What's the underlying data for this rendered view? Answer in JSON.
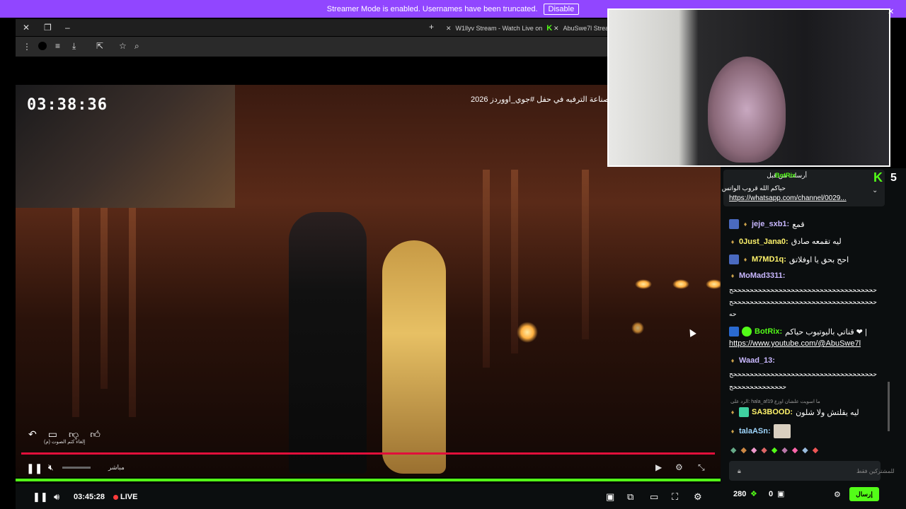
{
  "banner": {
    "text": "Streamer Mode is enabled. Usernames have been truncated.",
    "button": "Disable"
  },
  "browser": {
    "tabs": [
      {
        "title": "W1llyv Stream - Watch Live on"
      },
      {
        "title": "AbuSwe7l Strea"
      }
    ],
    "icons": {
      "close": "✕",
      "restore": "❐",
      "minimize": "–",
      "new_tab": "+"
    }
  },
  "video": {
    "timer": "03:38:36",
    "arabic_title": "صناعة الترفيه في حفل #جوي_اووردز 2026",
    "inner_caption": "إلغاء كتم الصوت (م)",
    "inner_live": "مباشر"
  },
  "player": {
    "time": "03:45:28",
    "live_label": "LIVE"
  },
  "chat": {
    "viewer_count": "5",
    "pinned": {
      "header": "أرسلت من قبل",
      "user": "BotRix",
      "message": "حياكم الله قروب الواتس",
      "url": "https://whatsapp.com/channel/0029..."
    },
    "messages": [
      {
        "user": "jeje_sxb1:",
        "color": "#c9b8ff",
        "text": "قمع"
      },
      {
        "user": "0Just_Jana0:",
        "color": "#fff36b",
        "text": "ليه تقمعه صادق"
      },
      {
        "user": "M7MD1q:",
        "color": "#fff36b",
        "text": "احح بحق يا اوفلاتق"
      },
      {
        "user": "MoMad3311:",
        "color": "#c9b8ff",
        "text": ""
      },
      {
        "user": "BotRix:",
        "color": "#53fc18",
        "text": "قناتي باليوتيوب حياكم ❤ |"
      },
      {
        "user": "Waad_13:",
        "color": "#c9b8ff",
        "text": ""
      },
      {
        "user": "SA3BOOD:",
        "color": "#fff36b",
        "text": "ليه يقلتش ولا شلون"
      },
      {
        "user": "talaASn:",
        "color": "#9fd7ff",
        "text": ""
      }
    ],
    "long_lines": [
      "حححححححححححححححححححححححححححححححححححح",
      "حححححححححححححححححححححححححححححححححححح",
      "حه",
      "https://www.youtube.com/@AbuSwe7l",
      "حححححححححححححححححححححححححححححححححححح",
      "حححححححححححححح"
    ],
    "reply_hint": "الرد على: hala_af19 ما اسويت علشان اوزع",
    "input_placeholder": "للمشتركين فقط",
    "points": "280",
    "zero": "0",
    "send": "إرسال"
  },
  "colors": {
    "kick_green": "#53fc18",
    "banner_purple": "#9146ff",
    "progress_red": "#e10f3b"
  }
}
